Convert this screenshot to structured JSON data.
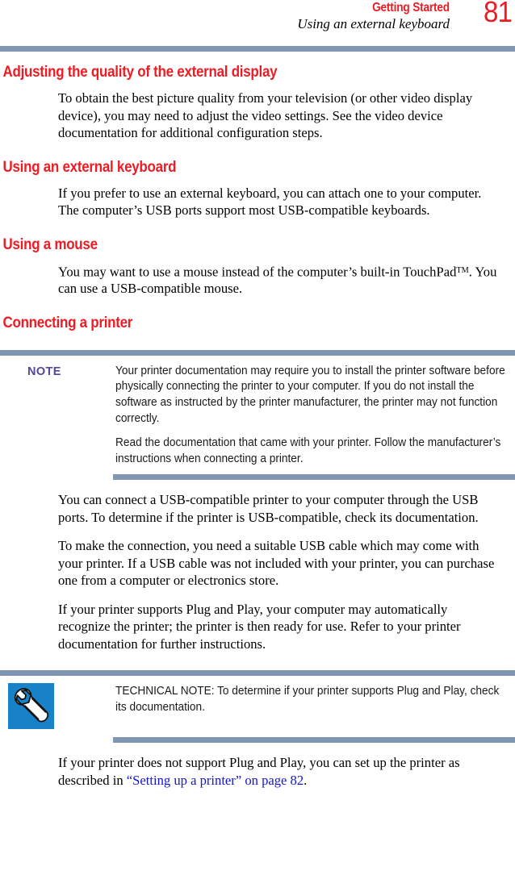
{
  "header": {
    "chapter": "Getting Started",
    "subject": "Using an external keyboard",
    "page_number": "81",
    "chapter_color": "#ed1c24",
    "rule_color": "#8196b0"
  },
  "sections": [
    {
      "heading": "Adjusting the quality of the external display",
      "paragraph": "To obtain the best picture quality from your television (or other video display device), you may need to adjust the video settings. See the video device documentation for additional configuration steps."
    },
    {
      "heading": "Using an external keyboard",
      "paragraph": "If you prefer to use an external keyboard, you can attach one to your computer. The computer’s USB ports support most USB-compatible keyboards."
    },
    {
      "heading": "Using a mouse",
      "paragraph_before_tm": "You may want to use a mouse instead of the computer’s built-in TouchPad",
      "trademark": "TM",
      "paragraph_after_tm": ". You can use a USB-compatible mouse."
    },
    {
      "heading": "Connecting a printer"
    }
  ],
  "note_block": {
    "label": "NOTE",
    "label_color": "#55469c",
    "paragraphs": [
      "Your printer documentation may require you to install the printer software before physically connecting the printer to your computer. If you do not install the software as instructed by the printer manufacturer, the printer may not function correctly.",
      "Read the documentation that came with your printer. Follow the manufacturer’s instructions when connecting a printer."
    ]
  },
  "printer_paragraphs": [
    "You can connect a USB-compatible printer to your computer through the USB ports. To determine if the printer is USB-compatible, check its documentation.",
    "To make the connection, you need a suitable USB cable which may come with your printer. If a USB cable was not included with your printer, you can purchase one from a computer or electronics store.",
    "If your printer supports Plug and Play, your computer may automatically recognize the printer; the printer is then ready for use. Refer to your printer documentation for further instructions."
  ],
  "technical_note": {
    "icon": "wrench-icon",
    "icon_background": "#1882c8",
    "text": "TECHNICAL NOTE: To determine if your printer supports Plug and Play, check its documentation."
  },
  "closing_paragraph": {
    "before_link": "If your printer does not support Plug and Play, you can set up the printer as described in ",
    "link_text": "“Setting up a printer” on page 82",
    "link_color": "#1313d8",
    "after_link": "."
  }
}
